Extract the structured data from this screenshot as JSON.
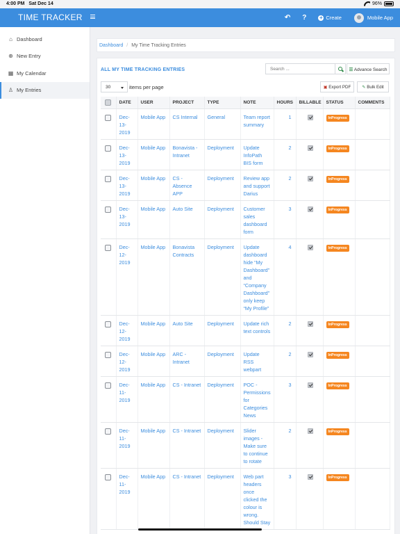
{
  "status_bar": {
    "time": "4:00 PM",
    "date": "Sat Dec 14",
    "battery": "96%"
  },
  "navbar": {
    "title": "TIME TRACKER",
    "back_icon": "↶",
    "help_icon": "?",
    "create_label": "Create",
    "user_name": "Mobile App"
  },
  "sidebar": {
    "items": [
      {
        "label": "Dashboard",
        "icon": "home-icon",
        "glyph": "⌂"
      },
      {
        "label": "New Entry",
        "icon": "plus-circle-icon",
        "glyph": "⊕"
      },
      {
        "label": "My Calendar",
        "icon": "calendar-icon",
        "glyph": "▦"
      },
      {
        "label": "My Entries",
        "icon": "user-icon",
        "glyph": "♙",
        "active": true
      }
    ]
  },
  "breadcrumb": {
    "home": "Dashboard",
    "current": "My Time Tracking Entries"
  },
  "panel": {
    "title": "ALL MY TIME TRACKING ENTRIES",
    "search_placeholder": "Search ...",
    "advance_search_label": "Advance Search",
    "advance_search_glyph": "☰",
    "page_size": "30",
    "per_page_label": "items per page",
    "export_pdf_label": "Export PDF",
    "bulk_edit_label": "Bulk Edit"
  },
  "table": {
    "columns": [
      "DATE",
      "USER",
      "PROJECT",
      "TYPE",
      "NOTE",
      "HOURS",
      "BILLABLE",
      "STATUS",
      "COMMENTS"
    ],
    "rows": [
      {
        "date": "Dec-13-2019",
        "user": "Mobile App",
        "project": "CS Internal",
        "type": "General",
        "note": "Team report summary",
        "hours": "1",
        "billable": true,
        "status": "InProgress",
        "comments": ""
      },
      {
        "date": "Dec-13-2019",
        "user": "Mobile App",
        "project": "Bonavista - Intranet",
        "type": "Deployment",
        "note": "Update InfoPath BIS form",
        "hours": "2",
        "billable": true,
        "status": "InProgress",
        "comments": ""
      },
      {
        "date": "Dec-13-2019",
        "user": "Mobile App",
        "project": "CS - Absence APP",
        "type": "Deployment",
        "note": "Review app and support Darius",
        "hours": "2",
        "billable": true,
        "status": "InProgress",
        "comments": ""
      },
      {
        "date": "Dec-13-2019",
        "user": "Mobile App",
        "project": "Auto Site",
        "type": "Deployment",
        "note": "Customer sales dashboard form",
        "hours": "3",
        "billable": true,
        "status": "InProgress",
        "comments": ""
      },
      {
        "date": "Dec-12-2019",
        "user": "Mobile App",
        "project": "Bonavista Contracts",
        "type": "Deployment",
        "note": "Update dashboard hide “My Dashboard” and “Company Dashboard” only keep “My Profile”",
        "hours": "4",
        "billable": true,
        "status": "InProgress",
        "comments": ""
      },
      {
        "date": "Dec-12-2019",
        "user": "Mobile App",
        "project": "Auto Site",
        "type": "Deployment",
        "note": "Update rich text controls",
        "hours": "2",
        "billable": true,
        "status": "InProgress",
        "comments": ""
      },
      {
        "date": "Dec-12-2019",
        "user": "Mobile App",
        "project": "ARC - Intranet",
        "type": "Deployment",
        "note": "Update RSS webpart",
        "hours": "2",
        "billable": true,
        "status": "InProgress",
        "comments": ""
      },
      {
        "date": "Dec-11-2019",
        "user": "Mobile App",
        "project": "CS - Intranet",
        "type": "Deployment",
        "note": "POC - Permissions for Categories News",
        "hours": "3",
        "billable": true,
        "status": "InProgress",
        "comments": ""
      },
      {
        "date": "Dec-11-2019",
        "user": "Mobile App",
        "project": "CS - Intranet",
        "type": "Deployment",
        "note": "Slider images - Make sure to continue to rotate",
        "hours": "2",
        "billable": true,
        "status": "InProgress",
        "comments": ""
      },
      {
        "date": "Dec-11-2019",
        "user": "Mobile App",
        "project": "CS - Intranet",
        "type": "Deployment",
        "note": "Web part headers once clicked the colour is wrong. Should Stay",
        "hours": "3",
        "billable": true,
        "status": "InProgress",
        "comments": ""
      }
    ]
  },
  "colors": {
    "primary": "#3c8dde",
    "status_inprogress": "#f5861f",
    "search_green": "#2e8a48",
    "pdf_red": "#c0392b"
  }
}
